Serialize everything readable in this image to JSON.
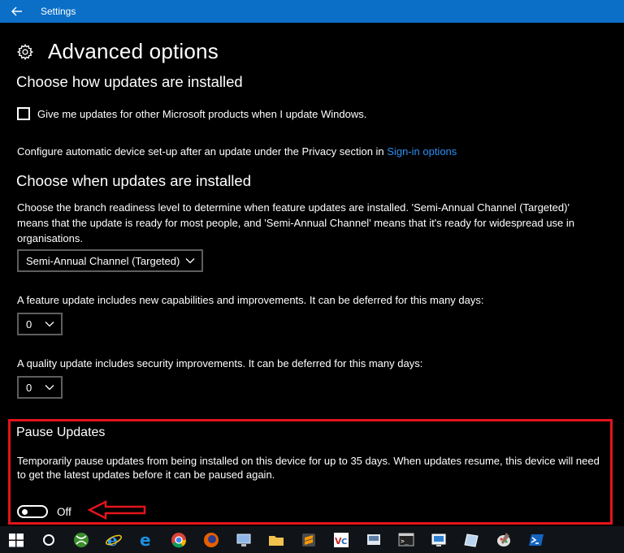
{
  "window": {
    "title": "Settings"
  },
  "header": {
    "title": "Advanced options"
  },
  "install_section": {
    "heading": "Choose how updates are installed",
    "checkbox_label": "Give me updates for other Microsoft products when I update Windows.",
    "checkbox_checked": false,
    "setup_text": "Configure automatic device set-up after an update under the Privacy section in",
    "setup_link": "Sign-in options"
  },
  "when_section": {
    "heading": "Choose when updates are installed",
    "branch_desc": "Choose the branch readiness level to determine when feature updates are installed. 'Semi-Annual Channel (Targeted)' means that the update is ready for most people, and 'Semi-Annual Channel' means that it's ready for widespread use in organisations.",
    "branch_value": "Semi-Annual Channel (Targeted)",
    "feature_desc": "A feature update includes new capabilities and improvements. It can be deferred for this many days:",
    "feature_value": "0",
    "quality_desc": "A quality update includes security improvements. It can be deferred for this many days:",
    "quality_value": "0"
  },
  "pause_section": {
    "heading": "Pause Updates",
    "description": "Temporarily pause updates from being installed on this device for up to 35 days. When updates resume, this device will need to get the latest updates before it can be paused again.",
    "toggle_state": "Off"
  },
  "colors": {
    "titlebar": "#0b6fc7",
    "link": "#2b8ff2",
    "highlight": "#e3141b"
  },
  "taskbar": {
    "items": [
      "windows-logo-icon",
      "cortana-icon",
      "xbox-icon",
      "ie-icon",
      "edge-icon",
      "chrome-icon",
      "firefox-icon",
      "computer-icon",
      "folder-icon",
      "sublime-icon",
      "vscode-icon",
      "mail-icon",
      "terminal-icon",
      "network-icon",
      "tablet-icon",
      "paint-icon",
      "powershell-icon"
    ]
  }
}
